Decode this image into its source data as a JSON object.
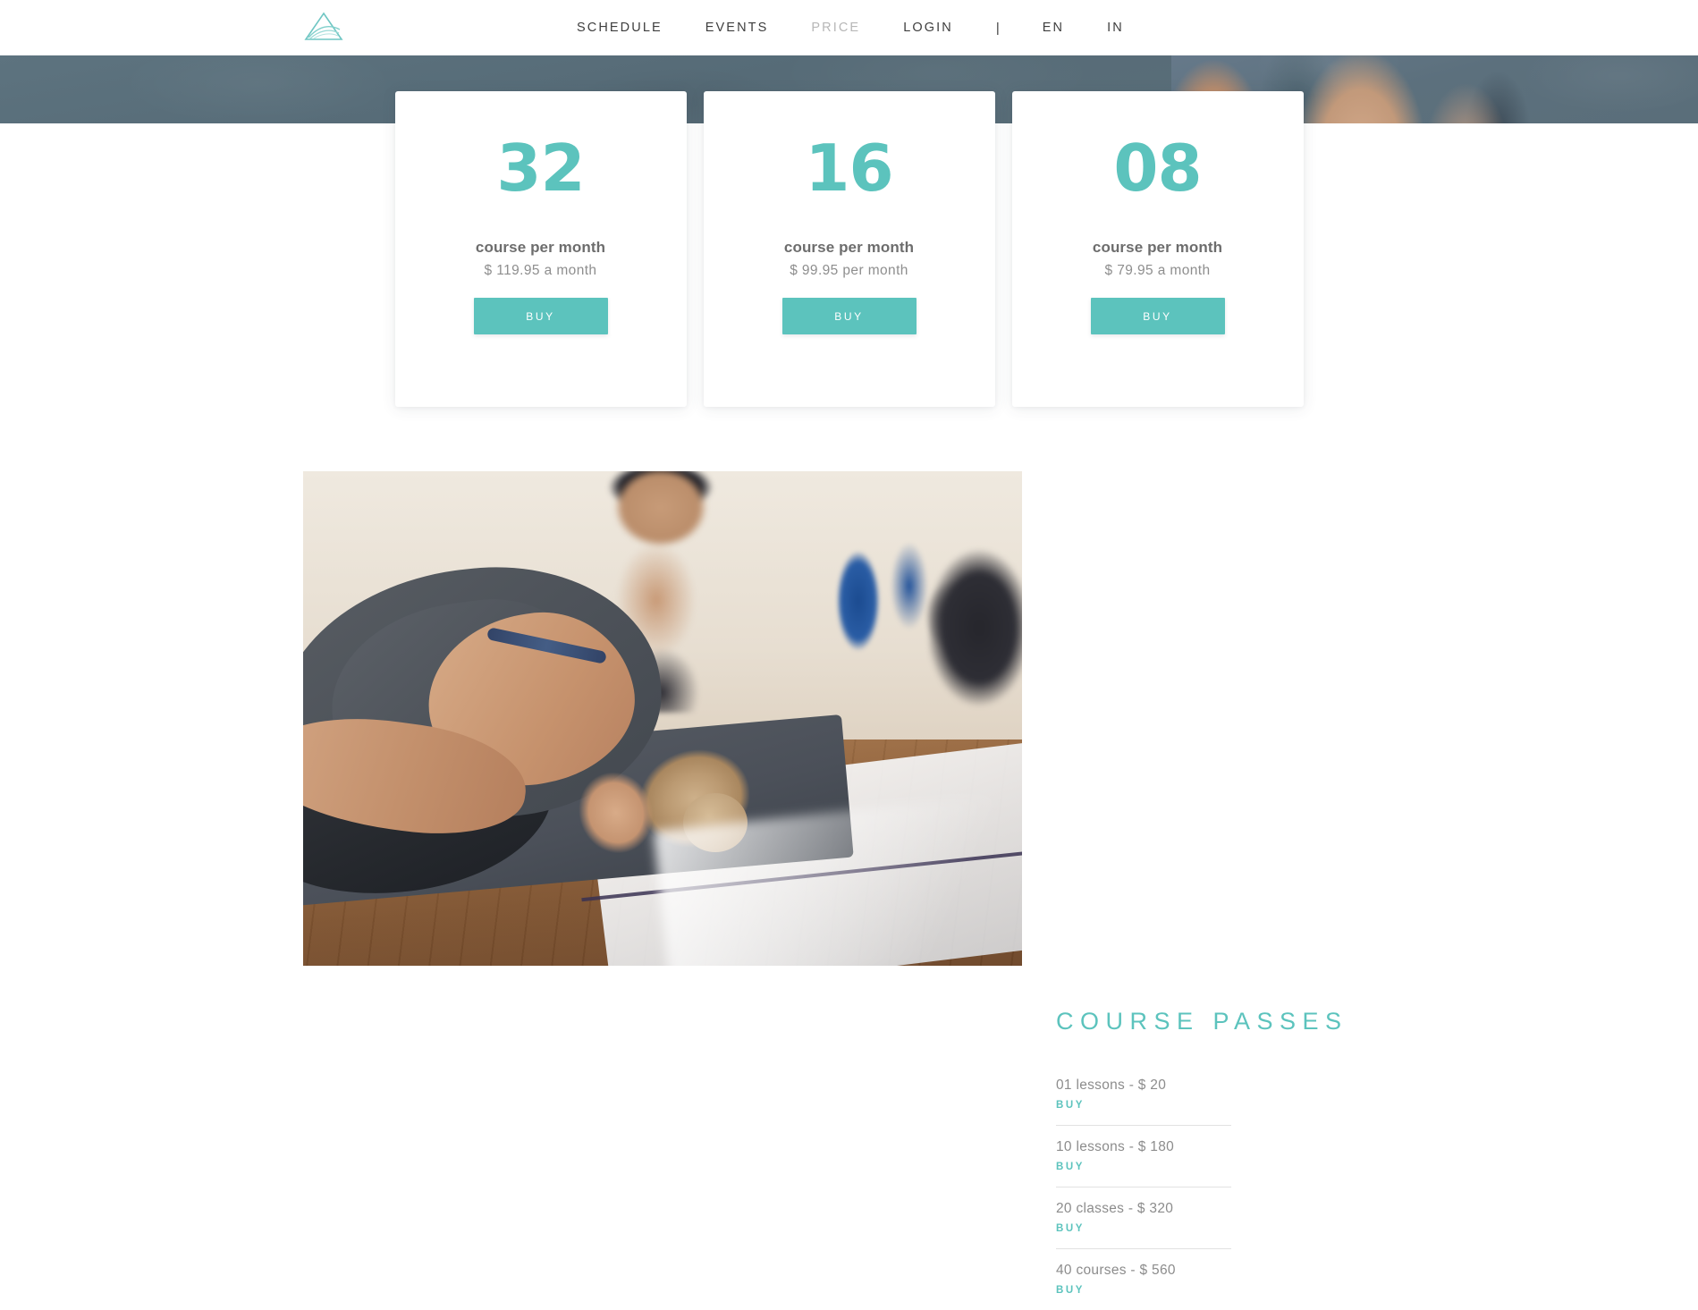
{
  "brand": {
    "logo_icon": "triangle-mountain-logo",
    "accent_color": "#5cc3bd"
  },
  "nav": {
    "items": [
      {
        "label": "SCHEDULE",
        "active": false
      },
      {
        "label": "EVENTS",
        "active": false
      },
      {
        "label": "PRICE",
        "active": true
      },
      {
        "label": "LOGIN",
        "active": false
      }
    ],
    "separator": "|",
    "languages": [
      {
        "label": "EN"
      },
      {
        "label": "IN"
      }
    ]
  },
  "pricing": {
    "cards": [
      {
        "count": "32",
        "unit": "course per month",
        "price": "$ 119.95 a month",
        "buy_label": "BUY"
      },
      {
        "count": "16",
        "unit": "course per month",
        "price": "$ 99.95 per month",
        "buy_label": "BUY"
      },
      {
        "count": "08",
        "unit": "course per month",
        "price": "$ 79.95 a month",
        "buy_label": "BUY"
      }
    ]
  },
  "passes": {
    "title": "COURSE PASSES",
    "items": [
      {
        "label": "01 lessons - $ 20",
        "buy_label": "BUY"
      },
      {
        "label": "10 lessons  - $ 180",
        "buy_label": "BUY"
      },
      {
        "label": "20 classes  - $ 320",
        "buy_label": "BUY"
      },
      {
        "label": "40 courses  - $ 560",
        "buy_label": "BUY"
      }
    ]
  },
  "media": {
    "hero_band_image": "yoga-class-cropped-legs",
    "feature_image": "woman-in-childs-pose-on-yoga-mat"
  }
}
